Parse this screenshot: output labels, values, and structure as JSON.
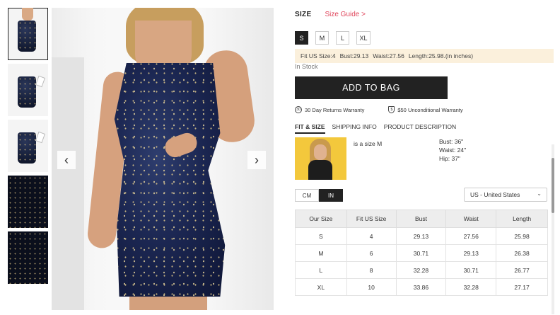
{
  "thumbnails": [
    {
      "name": "thumb-front"
    },
    {
      "name": "thumb-flat"
    },
    {
      "name": "thumb-flat-tag"
    },
    {
      "name": "thumb-fabric-detail"
    },
    {
      "name": "thumb-fabric-close"
    }
  ],
  "gallery": {
    "prev_icon": "‹",
    "next_icon": "›"
  },
  "size": {
    "label": "SIZE",
    "guide_link": "Size Guide >",
    "options": [
      "S",
      "M",
      "L",
      "XL"
    ],
    "selected": "S"
  },
  "fit_info": {
    "fit_us_size": "Fit US Size:4",
    "bust": "Bust:29.13",
    "waist": "Waist:27.56",
    "length": "Length:25.98.(in inches)"
  },
  "stock_status": "In Stock",
  "add_to_bag": "ADD TO BAG",
  "warranties": {
    "returns_icon": "30",
    "returns": "30 Day Returns Warranty",
    "unconditional_icon": "$",
    "unconditional": "$50 Unconditional Warranty"
  },
  "tabs": [
    "FIT & SIZE",
    "SHIPPING INFO",
    "PRODUCT DESCRIPTION"
  ],
  "model": {
    "size_text": "is a size M",
    "bust": "Bust: 36\"",
    "waist": "Waist: 24\"",
    "hip": "Hip: 37\""
  },
  "units": {
    "options": [
      "CM",
      "IN"
    ],
    "selected": "IN"
  },
  "country_select": {
    "value": "US - United States",
    "chevron": "⌄"
  },
  "size_table": {
    "headers": [
      "Our Size",
      "Fit US Size",
      "Bust",
      "Waist",
      "Length"
    ],
    "rows": [
      [
        "S",
        "4",
        "29.13",
        "27.56",
        "25.98"
      ],
      [
        "M",
        "6",
        "30.71",
        "29.13",
        "26.38"
      ],
      [
        "L",
        "8",
        "32.28",
        "30.71",
        "26.77"
      ],
      [
        "XL",
        "10",
        "33.86",
        "32.28",
        "27.17"
      ]
    ]
  },
  "colors": {
    "accent_link": "#e0465c",
    "primary_button": "#222222",
    "fit_bar_bg": "#fbf0dc"
  }
}
